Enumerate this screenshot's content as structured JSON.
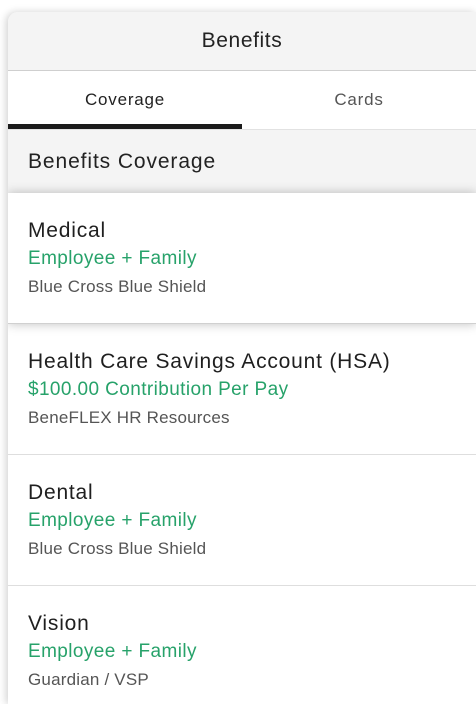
{
  "colors": {
    "accent_green": "#27a26a",
    "header_bg": "#f4f4f4",
    "active_tab_indicator": "#1b1b1b"
  },
  "header": {
    "title": "Benefits"
  },
  "tabs": [
    {
      "label": "Coverage",
      "active": true
    },
    {
      "label": "Cards",
      "active": false
    }
  ],
  "section": {
    "title": "Benefits Coverage"
  },
  "plans": [
    {
      "name": "Medical",
      "coverage": "Employee + Family",
      "provider": "Blue Cross Blue Shield",
      "selected": true
    },
    {
      "name": "Health Care Savings Account (HSA)",
      "coverage": "$100.00 Contribution Per Pay",
      "provider": "BeneFLEX HR Resources",
      "selected": false
    },
    {
      "name": "Dental",
      "coverage": "Employee + Family",
      "provider": "Blue Cross Blue Shield",
      "selected": false
    },
    {
      "name": "Vision",
      "coverage": "Employee + Family",
      "provider": "Guardian / VSP",
      "selected": false
    }
  ]
}
